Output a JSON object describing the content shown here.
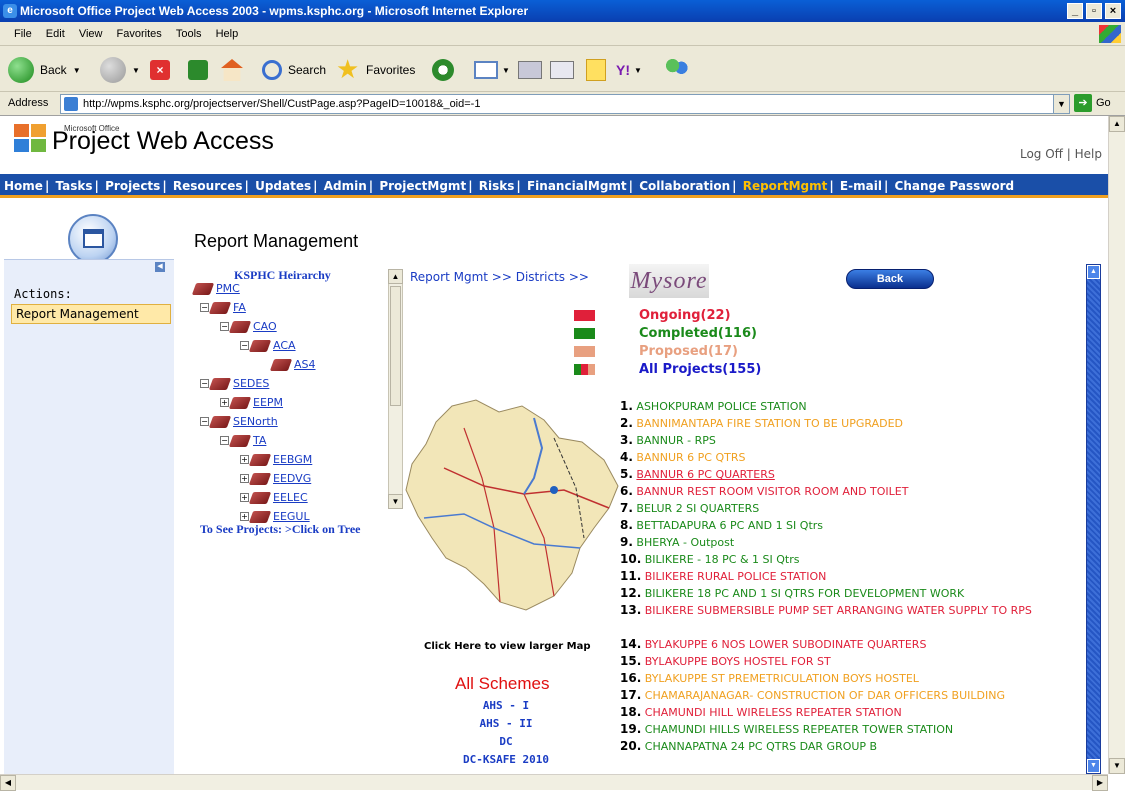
{
  "window": {
    "title": "Microsoft Office Project Web Access 2003 - wpms.ksphc.org - Microsoft Internet Explorer",
    "min": "_",
    "max": "▫",
    "close": "×"
  },
  "menu": [
    "File",
    "Edit",
    "View",
    "Favorites",
    "Tools",
    "Help"
  ],
  "toolbar": {
    "back": "Back",
    "search": "Search",
    "favorites": "Favorites"
  },
  "address": {
    "label": "Address",
    "url": "http://wpms.ksphc.org/projectserver/Shell/CustPage.asp?PageID=10018&_oid=-1",
    "go": "Go"
  },
  "app": {
    "ms_label": "Microsoft Office",
    "title": "Project Web Access",
    "logoff": "Log Off",
    "help": "Help",
    "sep": "|"
  },
  "nav": [
    "Home",
    "Tasks",
    "Projects",
    "Resources",
    "Updates",
    "Admin",
    "ProjectMgmt",
    "Risks",
    "FinancialMgmt",
    "Collaboration",
    "ReportMgmt",
    "E-mail",
    "Change Password"
  ],
  "page": {
    "title": "Report Management"
  },
  "sidebar": {
    "actions_label": "Actions:",
    "report_management": "Report Management"
  },
  "tree": {
    "title": "KSPHC Heirarchy",
    "nodes": [
      "PMC",
      "FA",
      "CAO",
      "ACA",
      "AS4",
      "SEDES",
      "EEPM",
      "SENorth",
      "TA",
      "EEBGM",
      "EEDVG",
      "EELEC",
      "EEGUL"
    ],
    "hint": "To See Projects: >Click on Tree"
  },
  "breadcrumb": "Report Mgmt >> Districts >>",
  "district": "Mysore",
  "back_label": "Back",
  "legend": [
    {
      "label": "Ongoing(22)",
      "color": "#e0203a"
    },
    {
      "label": "Completed(116)",
      "color": "#1a8a1a"
    },
    {
      "label": "Proposed(17)",
      "color": "#e8a080"
    },
    {
      "label": "All Projects(155)",
      "color": "#1a1ac8"
    }
  ],
  "map_caption": "Click Here to view larger Map",
  "schemes": {
    "title": "All Schemes",
    "items": [
      "AHS - I",
      "AHS - II",
      "DC",
      "DC-KSAFE 2010"
    ]
  },
  "projects": [
    {
      "num": "1.",
      "name": "ASHOKPURAM POLICE STATION",
      "color": "#1a8a1a"
    },
    {
      "num": "2.",
      "name": "BANNIMANTAPA FIRE STATION TO BE UPGRADED",
      "color": "#f0a020"
    },
    {
      "num": "3.",
      "name": "BANNUR - RPS",
      "color": "#1a8a1a"
    },
    {
      "num": "4.",
      "name": "BANNUR 6 PC QTRS",
      "color": "#f0a020"
    },
    {
      "num": "5.",
      "name": "BANNUR 6 PC QUARTERS",
      "color": "#e0203a"
    },
    {
      "num": "6.",
      "name": "BANNUR REST ROOM VISITOR ROOM AND TOILET",
      "color": "#e0203a"
    },
    {
      "num": "7.",
      "name": "BELUR 2 SI QUARTERS",
      "color": "#1a8a1a"
    },
    {
      "num": "8.",
      "name": "BETTADAPURA 6 PC AND 1 SI Qtrs",
      "color": "#1a8a1a"
    },
    {
      "num": "9.",
      "name": "BHERYA - Outpost",
      "color": "#1a8a1a"
    },
    {
      "num": "10.",
      "name": "BILIKERE - 18 PC & 1 SI Qtrs",
      "color": "#1a8a1a"
    },
    {
      "num": "11.",
      "name": "BILIKERE RURAL POLICE STATION",
      "color": "#e0203a"
    },
    {
      "num": "12.",
      "name": "BILIKERE 18 PC AND 1 SI QTRS FOR DEVELOPMENT WORK",
      "color": "#1a8a1a"
    },
    {
      "num": "13.",
      "name": "BILIKERE SUBMERSIBLE PUMP SET ARRANGING WATER SUPPLY TO RPS",
      "color": "#e0203a"
    },
    {
      "num": "14.",
      "name": "BYLAKUPPE 6 NOS LOWER SUBODINATE QUARTERS",
      "color": "#e0203a"
    },
    {
      "num": "15.",
      "name": "BYLAKUPPE BOYS HOSTEL FOR ST",
      "color": "#e0203a"
    },
    {
      "num": "16.",
      "name": "BYLAKUPPE ST PREMETRICULATION BOYS HOSTEL",
      "color": "#f0a020"
    },
    {
      "num": "17.",
      "name": "CHAMARAJANAGAR- CONSTRUCTION OF DAR OFFICERS BUILDING",
      "color": "#f0a020"
    },
    {
      "num": "18.",
      "name": "CHAMUNDI HILL WIRELESS REPEATER STATION",
      "color": "#e0203a"
    },
    {
      "num": "19.",
      "name": "CHAMUNDI HILLS WIRELESS REPEATER TOWER STATION",
      "color": "#1a8a1a"
    },
    {
      "num": "20.",
      "name": "CHANNAPATNA 24 PC QTRS DAR GROUP B",
      "color": "#1a8a1a"
    }
  ]
}
